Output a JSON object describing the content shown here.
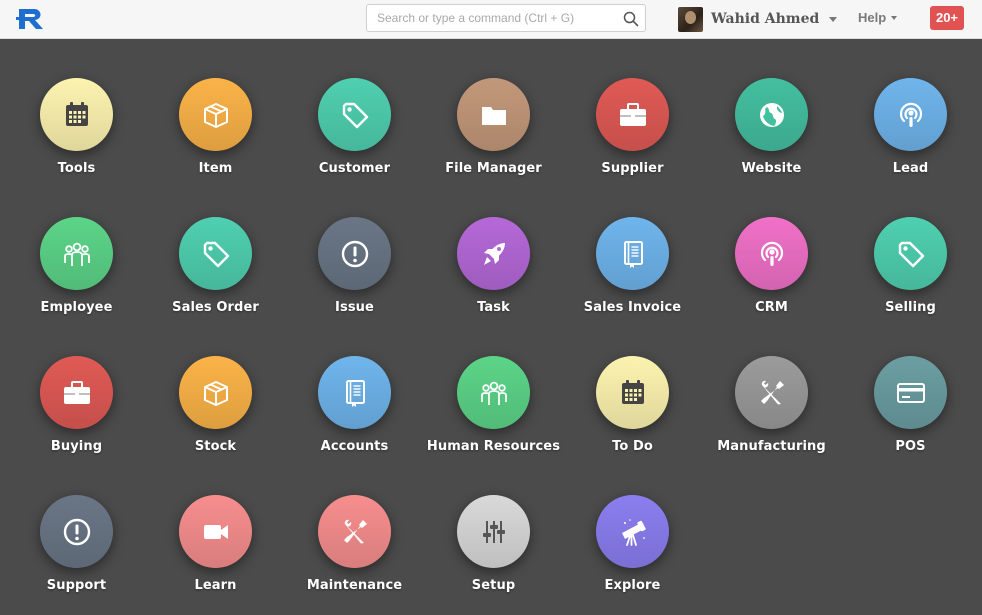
{
  "header": {
    "search_placeholder": "Search or type a command (Ctrl + G)",
    "user_name": "Wahid Ahmed",
    "help_label": "Help",
    "notification_count": "20+"
  },
  "colors": {
    "yellow": "#fdf3b0",
    "orange": "#fbb348",
    "teal": "#4fd0b0",
    "brown": "#c3987a",
    "red": "#e05a55",
    "green_teal": "#44bfa0",
    "blue": "#6fb5ec",
    "green": "#5cd588",
    "slate": "#6a7686",
    "purple": "#b569d8",
    "pink": "#f071c8",
    "grey": "#9b9b9b",
    "blue_grey": "#6b9ea2",
    "salmon": "#f78e8e",
    "light_grey": "#d9d9d9",
    "violet": "#8b7ef0"
  },
  "modules": [
    {
      "label": "Tools",
      "icon": "calendar-icon",
      "color": "#fdf3b0",
      "glyph": "#444444"
    },
    {
      "label": "Item",
      "icon": "box-icon",
      "color": "#fbb348",
      "glyph": "#ffffff"
    },
    {
      "label": "Customer",
      "icon": "tag-icon",
      "color": "#4fd0b0",
      "glyph": "#ffffff"
    },
    {
      "label": "File Manager",
      "icon": "folder-icon",
      "color": "#c3987a",
      "glyph": "#ffffff"
    },
    {
      "label": "Supplier",
      "icon": "briefcase-icon",
      "color": "#e05a55",
      "glyph": "#ffffff"
    },
    {
      "label": "Website",
      "icon": "globe-icon",
      "color": "#44bfa0",
      "glyph": "#ffffff"
    },
    {
      "label": "Lead",
      "icon": "podcast-icon",
      "color": "#6fb5ec",
      "glyph": "#ffffff"
    },
    {
      "label": "Employee",
      "icon": "group-icon",
      "color": "#5cd588",
      "glyph": "#ffffff"
    },
    {
      "label": "Sales Order",
      "icon": "tag-icon",
      "color": "#4fd0b0",
      "glyph": "#ffffff"
    },
    {
      "label": "Issue",
      "icon": "exclamation-icon",
      "color": "#6a7686",
      "glyph": "#ffffff"
    },
    {
      "label": "Task",
      "icon": "rocket-icon",
      "color": "#b569d8",
      "glyph": "#ffffff"
    },
    {
      "label": "Sales Invoice",
      "icon": "book-icon",
      "color": "#6fb5ec",
      "glyph": "#ffffff"
    },
    {
      "label": "CRM",
      "icon": "podcast-icon",
      "color": "#f071c8",
      "glyph": "#ffffff"
    },
    {
      "label": "Selling",
      "icon": "tag-icon",
      "color": "#4fd0b0",
      "glyph": "#ffffff"
    },
    {
      "label": "Buying",
      "icon": "briefcase-icon",
      "color": "#e05a55",
      "glyph": "#ffffff"
    },
    {
      "label": "Stock",
      "icon": "box-icon",
      "color": "#fbb348",
      "glyph": "#ffffff"
    },
    {
      "label": "Accounts",
      "icon": "book-icon",
      "color": "#6fb5ec",
      "glyph": "#ffffff"
    },
    {
      "label": "Human Resources",
      "icon": "group-icon",
      "color": "#5cd588",
      "glyph": "#ffffff"
    },
    {
      "label": "To Do",
      "icon": "calendar-icon",
      "color": "#fdf3b0",
      "glyph": "#444444"
    },
    {
      "label": "Manufacturing",
      "icon": "wrench-screwdriver-icon",
      "color": "#9b9b9b",
      "glyph": "#ffffff"
    },
    {
      "label": "POS",
      "icon": "credit-card-icon",
      "color": "#6b9ea2",
      "glyph": "#ffffff"
    },
    {
      "label": "Support",
      "icon": "exclamation-icon",
      "color": "#6a7686",
      "glyph": "#ffffff"
    },
    {
      "label": "Learn",
      "icon": "video-camera-icon",
      "color": "#f78e8e",
      "glyph": "#ffffff"
    },
    {
      "label": "Maintenance",
      "icon": "wrench-screwdriver-icon",
      "color": "#f78e8e",
      "glyph": "#ffffff"
    },
    {
      "label": "Setup",
      "icon": "sliders-icon",
      "color": "#d9d9d9",
      "glyph": "#555555"
    },
    {
      "label": "Explore",
      "icon": "telescope-icon",
      "color": "#8b7ef0",
      "glyph": "#ffffff"
    }
  ]
}
